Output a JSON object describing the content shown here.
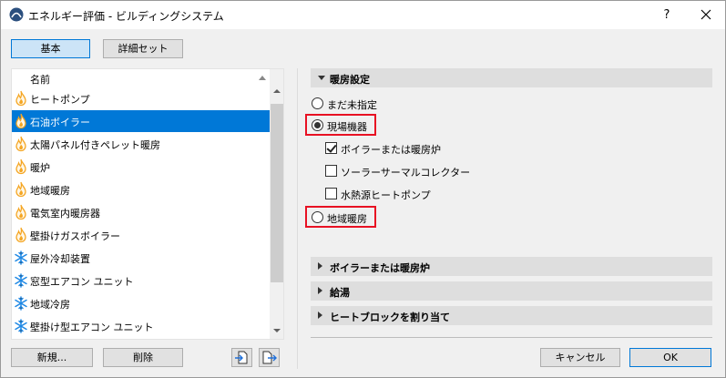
{
  "window": {
    "title": "エネルギー評価 - ビルディングシステム",
    "help": "?"
  },
  "mode_buttons": {
    "basic": "基本",
    "detailed": "詳細セット"
  },
  "list": {
    "header": "名前",
    "items": [
      {
        "label": "ヒートポンプ",
        "icon": "flame-icon",
        "selected": false
      },
      {
        "label": "石油ボイラー",
        "icon": "flame-icon",
        "selected": true
      },
      {
        "label": "太陽パネル付きペレット暖房",
        "icon": "flame-icon",
        "selected": false
      },
      {
        "label": "暖炉",
        "icon": "flame-icon",
        "selected": false
      },
      {
        "label": "地域暖房",
        "icon": "flame-icon",
        "selected": false
      },
      {
        "label": "電気室内暖房器",
        "icon": "flame-icon",
        "selected": false
      },
      {
        "label": "壁掛けガスボイラー",
        "icon": "flame-icon",
        "selected": false
      },
      {
        "label": "屋外冷却装置",
        "icon": "snowflake-icon",
        "selected": false
      },
      {
        "label": "窓型エアコン ユニット",
        "icon": "snowflake-icon",
        "selected": false
      },
      {
        "label": "地域冷房",
        "icon": "snowflake-icon",
        "selected": false
      },
      {
        "label": "壁掛け型エアコン ユニット",
        "icon": "snowflake-icon",
        "selected": false
      }
    ]
  },
  "list_buttons": {
    "new": "新規...",
    "delete": "削除"
  },
  "heating": {
    "title": "暖房設定",
    "unspecified": "まだ未指定",
    "onsite": "現場機器",
    "boiler": "ボイラーまたは暖房炉",
    "solar": "ソーラーサーマルコレクター",
    "water_hp": "水熱源ヒートポンプ",
    "district": "地域暖房",
    "selected_option": "現場機器",
    "boiler_checked": true,
    "solar_checked": false,
    "water_hp_checked": false
  },
  "sections": {
    "boiler": "ボイラーまたは暖房炉",
    "hot_water": "給湯",
    "assign": "ヒートブロックを割り当て"
  },
  "footer": {
    "cancel": "キャンセル",
    "ok": "OK"
  },
  "colors": {
    "selection": "#0078d7",
    "highlight": "#e81123",
    "flame": "#f5a623",
    "snowflake": "#1e88e5"
  }
}
